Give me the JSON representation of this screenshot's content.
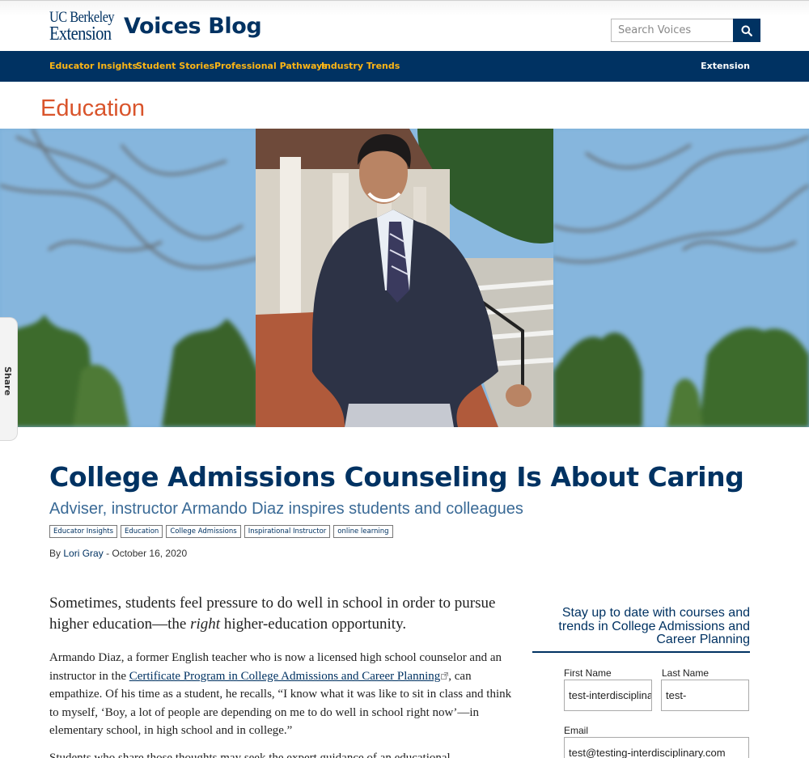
{
  "header": {
    "logo_line1": "UC Berkeley",
    "logo_line2": "Extension",
    "blog_title": "Voices Blog",
    "search_placeholder": "Search Voices",
    "search_icon": "search-icon"
  },
  "nav": {
    "items": [
      {
        "label": "Educator Insights"
      },
      {
        "label": "Student Stories"
      },
      {
        "label": "Professional Pathways"
      },
      {
        "label": "Industry Trends"
      }
    ],
    "extension_label": "Extension"
  },
  "section_title": "Education",
  "share_label": "Share",
  "article": {
    "title": "College Admissions Counseling Is About Caring",
    "subtitle": "Adviser, instructor Armando Diaz inspires students and colleagues",
    "tags": [
      "Educator Insights",
      "Education",
      "College Admissions",
      "Inspirational Instructor",
      "online learning"
    ],
    "byline_prefix": "By",
    "author": "Lori Gray",
    "date": "- October 16, 2020",
    "lead_part1": "Sometimes, students feel pressure to do well in school in order to pursue higher education—the ",
    "lead_em": "right",
    "lead_part2": " higher-education opportunity.",
    "p1_part1": "Armando Diaz, a former English teacher who is now a licensed high school counselor and an instructor in the ",
    "p1_link": "Certificate Program in College Admissions and Career Planning",
    "p1_part2": ", can empathize. Of his time as a student, he recalls, “I know what it was like to sit in class and think to myself, ‘Boy, a lot of people are depending on me to do well in school right now’—in elementary school, in high school and in college.”",
    "p2_partial": "Students who share those thoughts may seek the expert guidance of an educational"
  },
  "signup": {
    "title": "Stay up to date with courses and trends in College Admissions and Career Planning",
    "first_name_label": "First Name",
    "first_name_value": "test-interdisciplinary",
    "last_name_label": "Last Name",
    "last_name_value": "test-",
    "email_label": "Email",
    "email_value": "test@testing-interdisciplinary.com"
  },
  "colors": {
    "brand_navy": "#003262",
    "nav_gold": "#FDB515",
    "section_orange": "#d9542b"
  }
}
